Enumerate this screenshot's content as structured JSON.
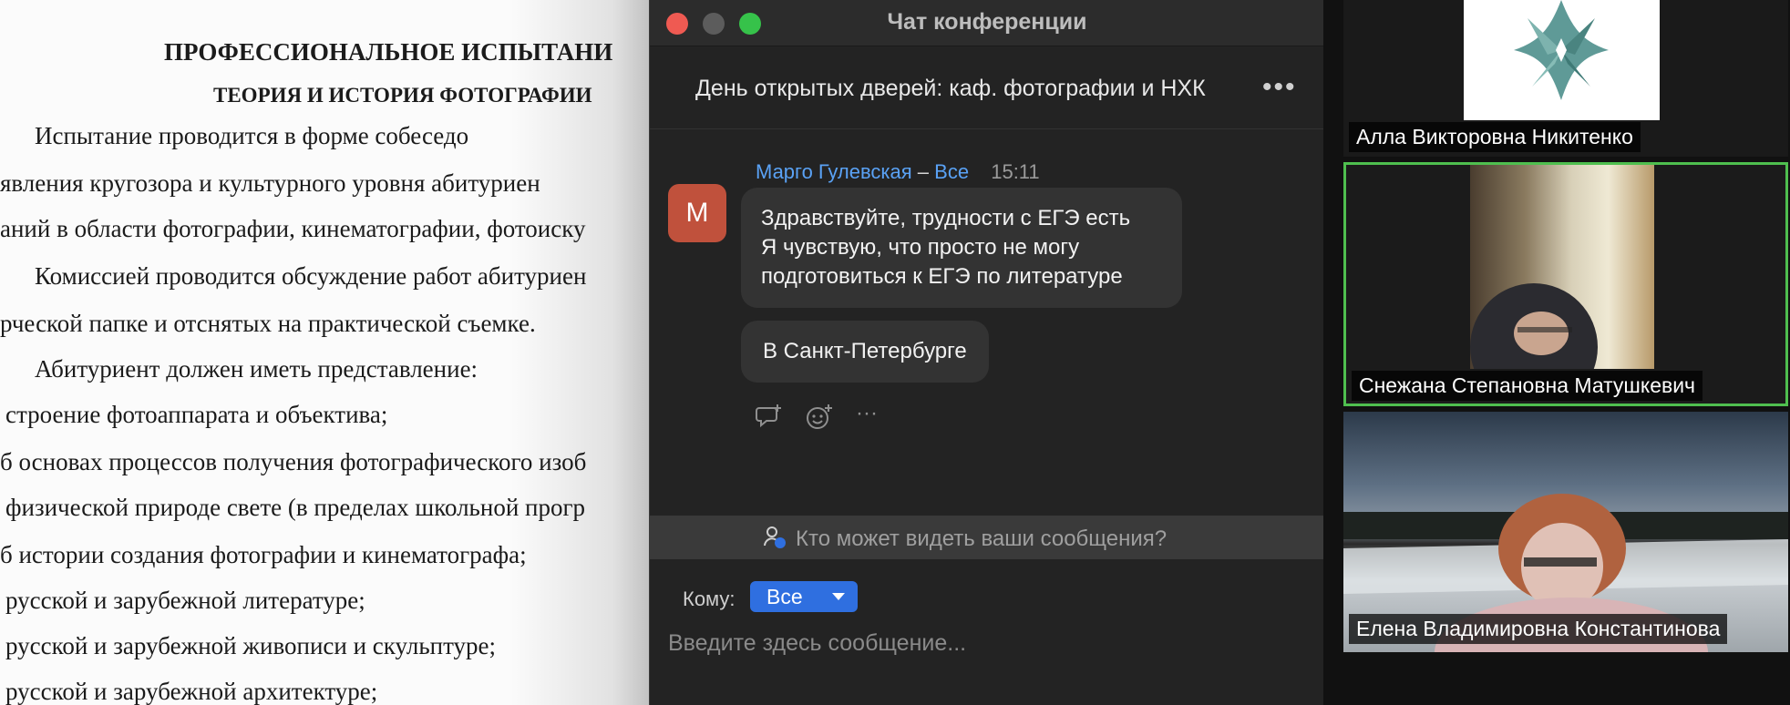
{
  "document": {
    "heading1": "ПРОФЕССИОНАЛЬНОЕ ИСПЫТАНИ",
    "heading2": "ТЕОРИЯ И ИСТОРИЯ ФОТОГРАФИИ",
    "lines": [
      "Испытание      проводится      в      форме      собеседо",
      "явления кругозора  и  культурного  уровня  абитуриен",
      "аний в области фотографии, кинематографии, фотоиску",
      "Комиссией проводится обсуждение работ абитуриен",
      "рческой папке и отснятых на практической съемке.",
      "Абитуриент должен иметь представление:",
      "строение фотоаппарата и объектива;",
      "б основах процессов получения фотографического изоб",
      "физической природе свете (в пределах школьной прогр",
      "б истории создания фотографии и кинематографа;",
      "русской и зарубежной литературе;",
      "русской и зарубежной живописи и скульптуре;",
      "русской и зарубежной архитектуре;"
    ]
  },
  "chat": {
    "window_title": "Чат конференции",
    "meeting_name": "День открытых дверей: каф. фотографии и НХК",
    "more_label": "•••",
    "message": {
      "avatar_letter": "M",
      "sender": "Марго Гулевская",
      "separator": "–",
      "recipient": "Все",
      "time": "15:11",
      "bubble1_lines": [
        "Здравствуйте, трудности с ЕГЭ есть",
        "Я чувствую, что просто не могу",
        "подготовиться к ЕГЭ по литературе"
      ],
      "bubble2": "В Санкт-Петербурге"
    },
    "actions": {
      "more": "···"
    },
    "visibility_notice": "Кто может видеть ваши сообщения?",
    "to_label": "Кому:",
    "to_value": "Все",
    "input_placeholder": "Введите здесь сообщение..."
  },
  "gallery": {
    "participants": [
      {
        "name": "Алла Викторовна Никитенко"
      },
      {
        "name": "Снежана Степановна Матушкевич"
      },
      {
        "name": "Елена Владимировна Константинова"
      }
    ],
    "active_speaker_color": "#4fbf4f"
  },
  "colors": {
    "accent_blue": "#2f6fe0",
    "link_blue": "#5aa2f5",
    "avatar_red": "#c0513c"
  }
}
